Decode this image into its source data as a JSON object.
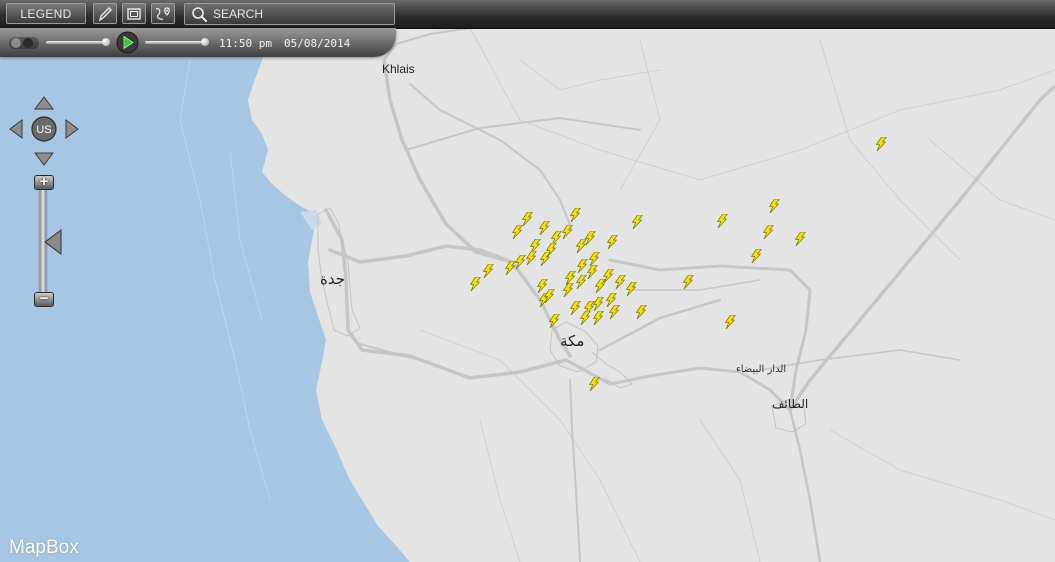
{
  "toolbar": {
    "legend_label": "LEGEND",
    "draw_icon": "pencil-icon",
    "frame_icon": "screen-icon",
    "route_icon": "route-pin-icon",
    "search_placeholder": "SEARCH"
  },
  "timeline": {
    "time": "11:50 pm",
    "date": "05/08/2014",
    "play_icon": "play-icon",
    "play_color": "#3fc33f"
  },
  "nav": {
    "center_label": "US"
  },
  "zoom": {
    "plus_label": "+",
    "minus_label": "−"
  },
  "map": {
    "sea_color": "#a7c6e3",
    "land_color": "#e4e4e4",
    "labels": {
      "khlais": "Khlais",
      "jeddah": "جدة",
      "makkah": "مكة",
      "dar_albaida": "الدار البيضاء",
      "taif": "الطائف"
    },
    "marker_icon": "lightning-icon",
    "marker_color": "#f2e400"
  },
  "attribution": {
    "mapbox": "MapBox"
  }
}
